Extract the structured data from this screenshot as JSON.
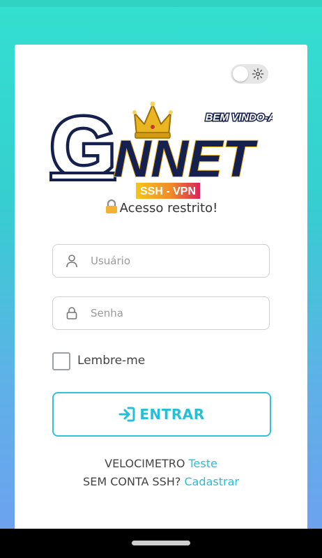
{
  "brand": {
    "welcome": "BEM VINDO-A",
    "name_letter": "G",
    "name_rest": "NNET",
    "tagline": "SSH - VPN"
  },
  "login": {
    "restricted_text": "Acesso restrito!",
    "username_placeholder": "Usuário",
    "password_placeholder": "Senha",
    "remember_label": "Lembre-me",
    "enter_label": "ENTRAR"
  },
  "footer_links": {
    "speed_prefix": "VELOCIMETRO",
    "speed_link": "Teste",
    "signup_prefix": "SEM CONTA SSH?",
    "signup_link": "Cadastrar"
  },
  "theme": {
    "accent": "#25bfd6",
    "logo_navy": "#16204f",
    "crown_gold": "#e9b520",
    "background_gradient": [
      "#33e0cf",
      "#6f9ff0"
    ]
  },
  "icons": [
    "gear-icon",
    "crown-icon",
    "padlock-icon",
    "user-icon",
    "lock-icon",
    "login-arrow-icon"
  ],
  "state": {
    "theme_toggle_on": false,
    "remember_checked": false
  }
}
